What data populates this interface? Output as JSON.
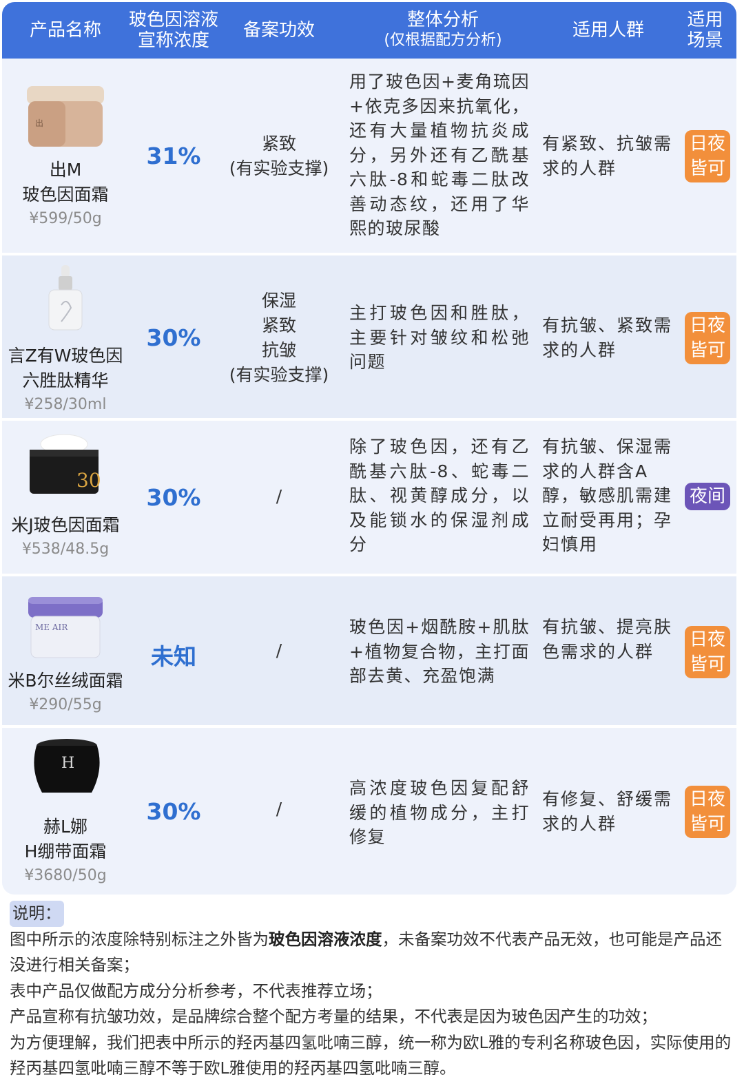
{
  "header": {
    "col_product": "产品名称",
    "col_conc_l1": "玻色因溶液",
    "col_conc_l2": "宣称浓度",
    "col_effect": "备案功效",
    "col_analysis_l1": "整体分析",
    "col_analysis_l2": "(仅根据配方分析)",
    "col_group": "适用人群",
    "col_scene_l1": "适用",
    "col_scene_l2": "场景"
  },
  "rows": [
    {
      "name_l1": "出M",
      "name_l2": "玻色因面霜",
      "price": "¥599/50g",
      "concentration": "31%",
      "effect_l1": "紧致",
      "effect_l2": "(有实验支撑)",
      "analysis": "用了玻色因+麦角琉因+依克多因来抗氧化，还有大量植物抗炎成分，另外还有乙酰基六肽-8和蛇毒二肽改善动态纹，还用了华熙的玻尿酸",
      "group": "有紧致、抗皱需求的人群",
      "scene_l1": "日夜",
      "scene_l2": "皆可",
      "icon": "cream-jar-icon"
    },
    {
      "name_l1": "言Z有W玻色因",
      "name_l2": "六胜肽精华",
      "price": "¥258/30ml",
      "concentration": "30%",
      "effect_l1": "保湿",
      "effect_l2": "紧致",
      "effect_l3": "抗皱",
      "effect_l4": "(有实验支撑)",
      "analysis": "主打玻色因和胜肽，主要针对皱纹和松弛问题",
      "group": "有抗皱、紧致需求的人群",
      "scene_l1": "日夜",
      "scene_l2": "皆可",
      "icon": "serum-bottle-icon"
    },
    {
      "name_l1": "米J玻色因面霜",
      "price": "¥538/48.5g",
      "concentration": "30%",
      "effect_l1": "/",
      "analysis": "除了玻色因，还有乙酰基六肽-8、蛇毒二肽、视黄醇成分，以及能锁水的保湿剂成分",
      "group": "有抗皱、保湿需求的人群含A醇，敏感肌需建立耐受再用；孕妇慎用",
      "scene_l1": "夜间",
      "icon": "cream-jar-icon"
    },
    {
      "name_l1": "米B尔丝绒面霜",
      "price": "¥290/55g",
      "concentration": "未知",
      "effect_l1": "/",
      "analysis": "玻色因+烟酰胺+肌肽+植物复合物，主打面部去黄、充盈饱满",
      "group": "有抗皱、提亮肤色需求的人群",
      "scene_l1": "日夜",
      "scene_l2": "皆可",
      "icon": "cream-jar-icon"
    },
    {
      "name_l1": "赫L娜",
      "name_l2": "H绷带面霜",
      "price": "¥3680/50g",
      "concentration": "30%",
      "effect_l1": "/",
      "analysis": "高浓度玻色因复配舒缓的植物成分，主打修复",
      "group": "有修复、舒缓需求的人群",
      "scene_l1": "日夜",
      "scene_l2": "皆可",
      "icon": "cream-jar-icon"
    }
  ],
  "notes": {
    "title": "说明：",
    "line1_a": "图中所示的浓度除特别标注之外皆为",
    "line1_b": "玻色因溶液浓度",
    "line1_c": "，未备案功效不代表产品无效，也可能是产品还没进行相关备案；",
    "line2": "表中产品仅做配方成分分析参考，不代表推荐立场；",
    "line3": "产品宣称有抗皱功效，是品牌综合整个配方考量的结果，不代表是因为玻色因产生的功效；",
    "line4": "为方便理解，我们把表中所示的羟丙基四氢吡喃三醇，统一称为欧L雅的专利名称玻色因，实际使用的羟丙基四氢吡喃三醇不等于欧L雅使用的羟丙基四氢吡喃三醇。"
  },
  "colors": {
    "header_bg": "#3f72db",
    "concentration": "#2f6fd0",
    "badge_day_night": "#f28f3b",
    "badge_night": "#6c55b8"
  }
}
